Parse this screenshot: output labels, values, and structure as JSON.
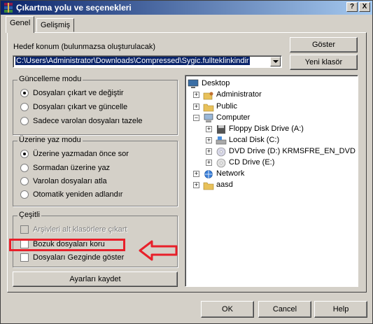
{
  "window": {
    "title": "Çıkartma yolu ve seçenekleri",
    "help_glyph": "?",
    "close_glyph": "X"
  },
  "tabs": [
    {
      "label": "Genel"
    },
    {
      "label": "Gelişmiş"
    }
  ],
  "destination": {
    "label": "Hedef konum (bulunmazsa oluşturulacak)",
    "value": "C:\\Users\\Administrator\\Downloads\\Compressed\\Sygic.fullteklinkindir"
  },
  "side_buttons": {
    "show": "Göster",
    "new_folder": "Yeni klasör"
  },
  "update_mode": {
    "title": "Güncelleme modu",
    "options": [
      {
        "label": "Dosyaları çıkart ve değiştir",
        "selected": true
      },
      {
        "label": "Dosyaları çıkart ve güncelle",
        "selected": false
      },
      {
        "label": "Sadece varolan dosyaları tazele",
        "selected": false
      }
    ]
  },
  "overwrite_mode": {
    "title": "Üzerine yaz modu",
    "options": [
      {
        "label": "Üzerine yazmadan önce sor",
        "selected": true
      },
      {
        "label": "Sormadan üzerine yaz",
        "selected": false
      },
      {
        "label": "Varolan dosyaları atla",
        "selected": false
      },
      {
        "label": "Otomatik yeniden adlandır",
        "selected": false
      }
    ]
  },
  "misc": {
    "title": "Çeşitli",
    "options": [
      {
        "label": "Arşivleri alt klasörlere çıkart",
        "checked": false,
        "disabled": true
      },
      {
        "label": "Bozuk dosyaları koru",
        "checked": false,
        "disabled": false
      },
      {
        "label": "Dosyaları Gezginde göster",
        "checked": false,
        "disabled": false
      }
    ]
  },
  "save_settings": "Ayarları kaydet",
  "tree": {
    "nodes": [
      {
        "label": "Desktop",
        "icon": "desktop-icon"
      },
      {
        "label": "Administrator",
        "icon": "user-folder-icon"
      },
      {
        "label": "Public",
        "icon": "folder-icon"
      },
      {
        "label": "Computer",
        "icon": "computer-icon"
      },
      {
        "label": "Floppy Disk Drive (A:)",
        "icon": "floppy-icon"
      },
      {
        "label": "Local Disk (C:)",
        "icon": "disk-icon"
      },
      {
        "label": "DVD Drive (D:) KRMSFRE_EN_DVD",
        "icon": "dvd-icon"
      },
      {
        "label": "CD Drive (E:)",
        "icon": "cd-icon"
      },
      {
        "label": "Network",
        "icon": "network-icon"
      },
      {
        "label": "aasd",
        "icon": "folder-icon"
      }
    ]
  },
  "bottom_buttons": {
    "ok": "OK",
    "cancel": "Cancel",
    "help": "Help"
  },
  "colors": {
    "annotation": "#e8202a",
    "title_bar": "#0a246a",
    "face": "#d4d0c8"
  }
}
